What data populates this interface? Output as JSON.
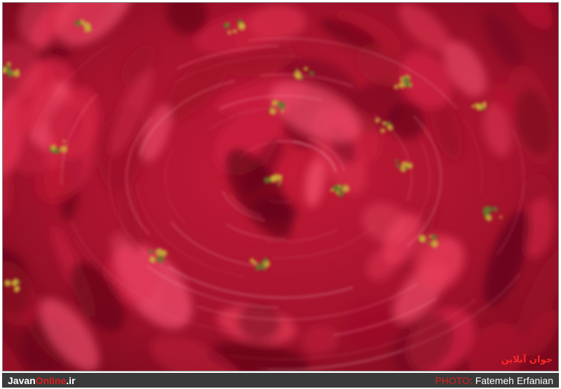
{
  "photo": {
    "subject": "Poinsettia",
    "colors": {
      "base": "#9e1028",
      "highlight": "#e63a58",
      "deep": "#5e0616",
      "bract_centers": "#c9b238"
    },
    "watermark_text": "جوان آنلاین"
  },
  "caption": {
    "site_part1": "Javan",
    "site_part2": "Online",
    "site_part3": ".ir",
    "photo_label": "PHOTO:",
    "photographer": "Fatemeh Erfanian"
  }
}
